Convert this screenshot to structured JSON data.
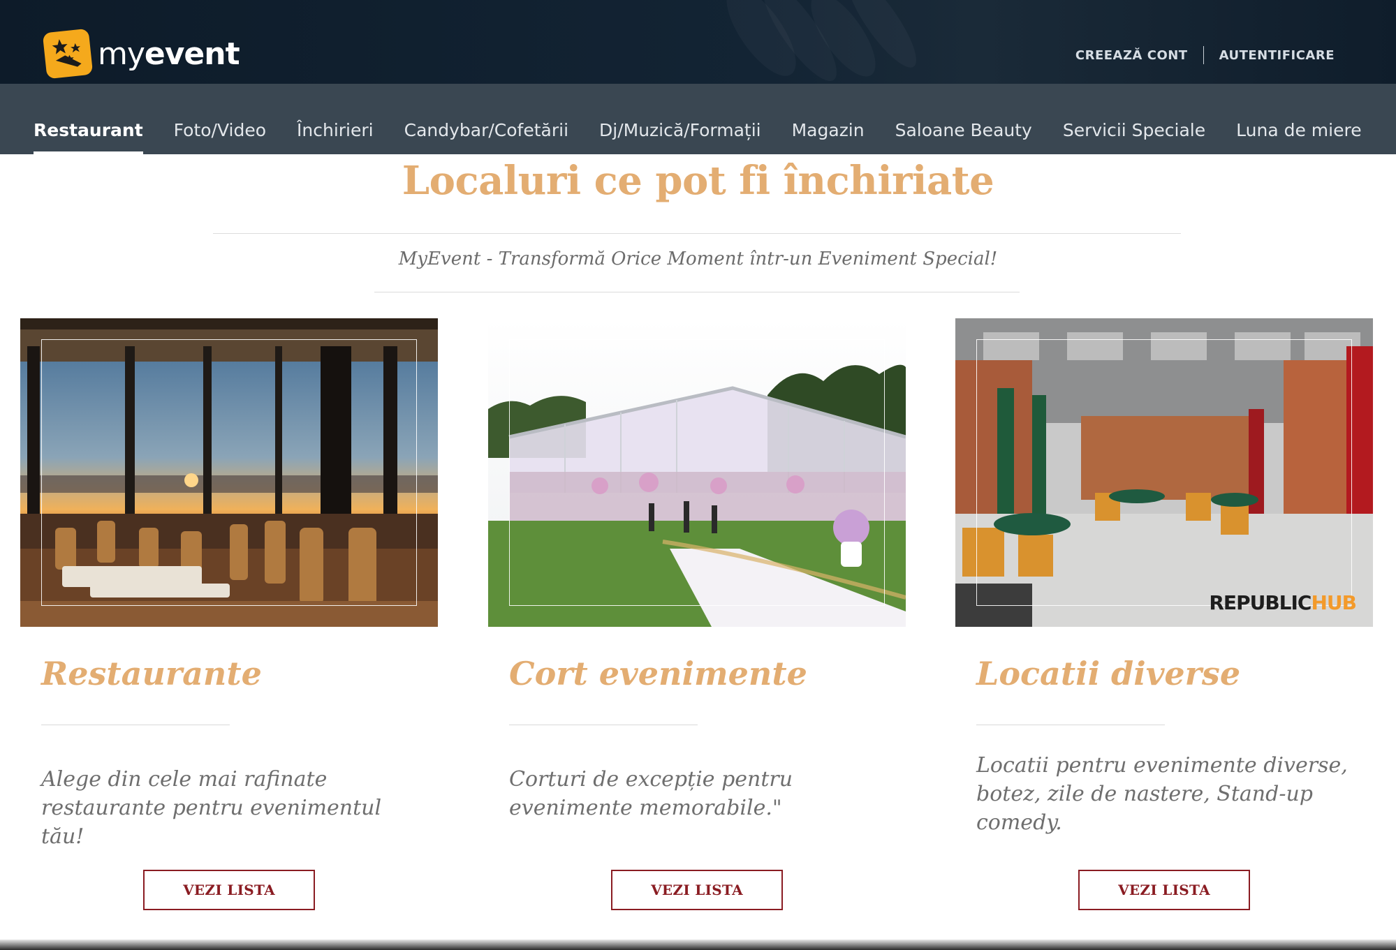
{
  "brand": {
    "name_light": "my",
    "name_bold": "event",
    "logo_icon": "stars-badge-icon",
    "accent_color": "#f5a91c"
  },
  "auth": {
    "create_account": "CREEAZĂ CONT",
    "login": "AUTENTIFICARE"
  },
  "nav": {
    "active_index": 0,
    "items": [
      "Restaurant",
      "Foto/Video",
      "Închirieri",
      "Candybar/Cofetării",
      "Dj/Muzică/Formații",
      "Magazin",
      "Saloane Beauty",
      "Servicii Speciale",
      "Luna de miere"
    ]
  },
  "main": {
    "title": "Localuri ce pot fi închiriate",
    "subtitle": "MyEvent - Transformă Orice Moment într-un Eveniment Special!",
    "title_color": "#e3ad72"
  },
  "cards": [
    {
      "title": "Restaurante",
      "description": "Alege din cele mai rafinate restaurante pentru evenimentul tău!",
      "button": "VEZI LISTA",
      "image": "restaurant-sunset-photo"
    },
    {
      "title": "Cort evenimente",
      "description": "Corturi de excepție pentru evenimente memorabile.\"",
      "button": "VEZI LISTA",
      "image": "event-tent-photo"
    },
    {
      "title": "Locatii diverse",
      "description": "Locatii pentru evenimente diverse, botez, zile de nastere, Stand-up comedy.",
      "button": "VEZI LISTA",
      "image": "venue-hall-photo",
      "watermark_logo": "REPUBLICHUB"
    }
  ],
  "button_color": "#8a1c22"
}
